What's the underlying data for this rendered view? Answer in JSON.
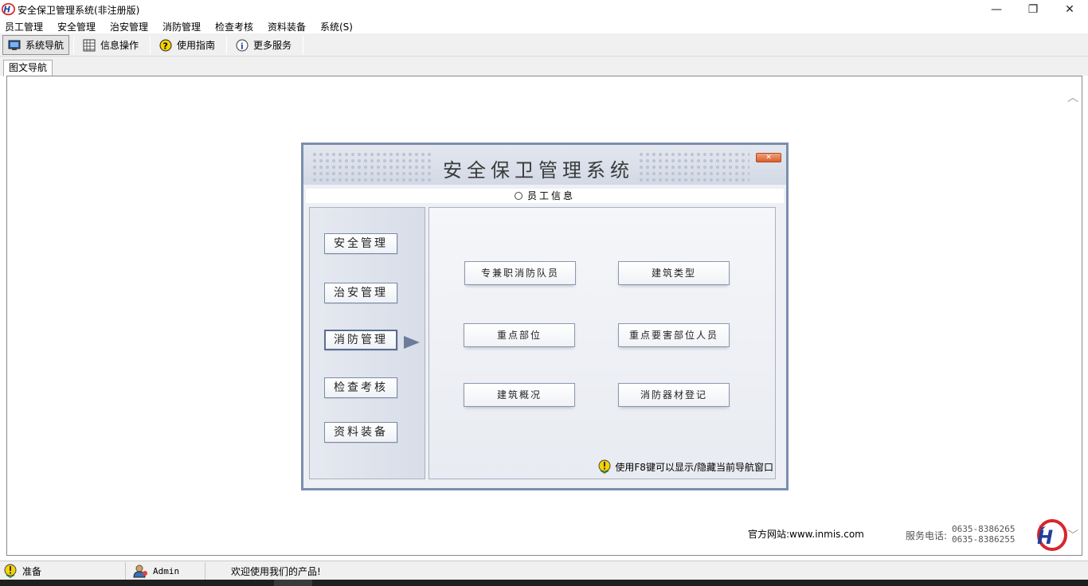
{
  "window": {
    "title": "安全保卫管理系统(非注册版)",
    "minimize_glyph": "—",
    "restore_glyph": "❐",
    "close_glyph": "✕"
  },
  "menu": [
    "员工管理",
    "安全管理",
    "治安管理",
    "消防管理",
    "检查考核",
    "资料装备",
    "系统(S)"
  ],
  "toolbar": {
    "items": [
      {
        "label": "系统导航",
        "icon": "monitor-icon",
        "active": true
      },
      {
        "label": "信息操作",
        "icon": "grid-icon",
        "active": false
      },
      {
        "label": "使用指南",
        "icon": "help-icon",
        "active": false
      },
      {
        "label": "更多服务",
        "icon": "info-icon",
        "active": false
      }
    ]
  },
  "tab": {
    "label": "图文导航"
  },
  "nav": {
    "title": "安全保卫管理系统",
    "close_glyph": "✕",
    "section": "员工信息",
    "categories": [
      "安全管理",
      "治安管理",
      "消防管理",
      "检查考核",
      "资料装备"
    ],
    "selected_category": "消防管理",
    "functions": [
      "专兼职消防队员",
      "建筑类型",
      "重点部位",
      "重点要害部位人员",
      "建筑概况",
      "消防器材登记"
    ],
    "hint": "使用F8键可以显示/隐藏当前导航窗口"
  },
  "footer": {
    "site": "官方网站:www.inmis.com",
    "phone_label": "服务电话:",
    "phones": [
      "0635-8386265",
      "0635-8386255"
    ]
  },
  "status": {
    "state": "准备",
    "user": "Admin",
    "message": "欢迎使用我们的产品!"
  },
  "colors": {
    "frame": "#7b8ead",
    "accent_red": "#d8262a",
    "accent_blue": "#1f3f9c"
  }
}
